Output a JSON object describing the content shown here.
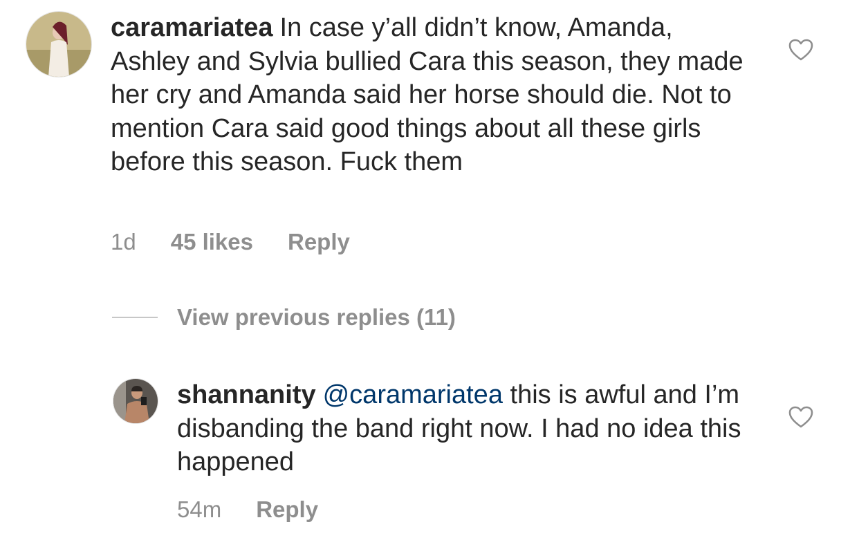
{
  "comment": {
    "avatar_icon": "user-avatar-icon",
    "username": "caramariatea",
    "text": "In case y’all didn’t know, Amanda, Ashley and Sylvia bullied Cara this season, they made her cry and Amanda said her horse should die. Not to mention Cara said good things about all these girls before this season. Fuck them",
    "time": "1d",
    "likes": "45 likes",
    "reply_label": "Reply",
    "like_icon": "heart-icon"
  },
  "view_replies": {
    "label": "View previous replies (11)"
  },
  "reply": {
    "avatar_icon": "user-avatar-icon",
    "username": "shannanity",
    "mention": "@caramariatea",
    "text": "this is awful and I’m disbanding the band right now. I had no idea this happened",
    "time": "54m",
    "reply_label": "Reply",
    "like_icon": "heart-icon"
  },
  "colors": {
    "text": "#262626",
    "secondary": "#8e8e8e",
    "mention": "#00376b",
    "divider": "#c7c7c7"
  }
}
